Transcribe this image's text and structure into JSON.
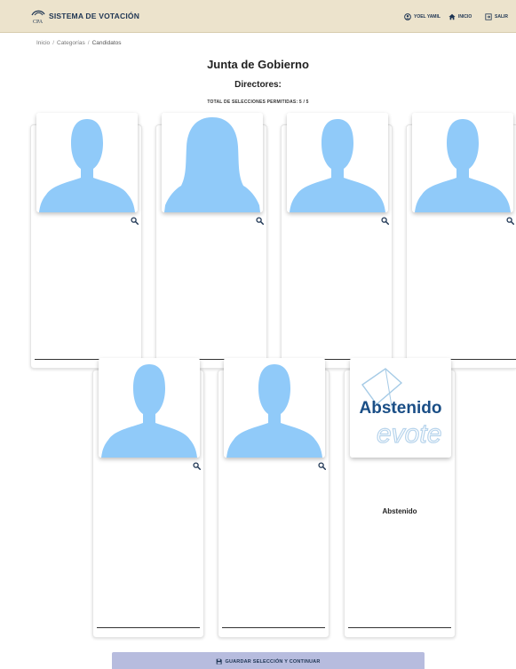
{
  "header": {
    "logo_text": "CPA",
    "title": "SISTEMA DE VOTACIÓN",
    "user_label": "YOEL YAMIL",
    "home_label": "INICIO",
    "exit_label": "SALIR"
  },
  "breadcrumb": [
    "Inicio",
    "Categorías",
    "Candidatos"
  ],
  "page_title": "Junta de Gobierno",
  "section_title": "Directores:",
  "selection_count": "TOTAL DE SELECCIONES PERMITIDAS: 5 / 5",
  "candidates": [
    {
      "avatar": "male-avatar-icon",
      "name": ""
    },
    {
      "avatar": "female-avatar-icon",
      "name": ""
    },
    {
      "avatar": "male-avatar-icon",
      "name": ""
    },
    {
      "avatar": "male-avatar-icon",
      "name": ""
    },
    {
      "avatar": "male-avatar-icon",
      "name": ""
    },
    {
      "avatar": "male-avatar-icon",
      "name": ""
    }
  ],
  "abstain": {
    "image_text": "Abstenido",
    "watermark_text": "evote",
    "name": "Abstenido"
  },
  "save_button_label": "GUARDAR SELECCIÓN Y CONTINUAR",
  "colors": {
    "header_bg": "#ece3cc",
    "navy": "#1e3553",
    "avatar_blue": "#90caf9",
    "save_button_bg": "#b7bcde"
  }
}
